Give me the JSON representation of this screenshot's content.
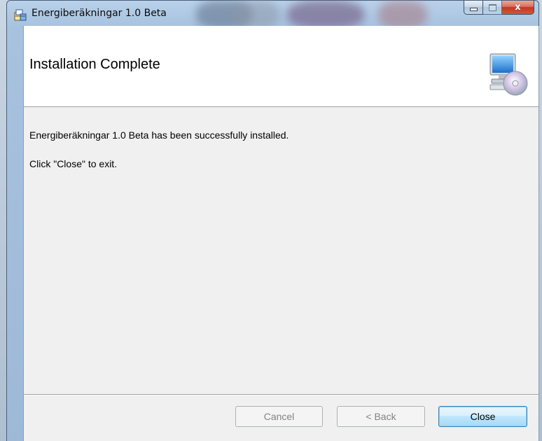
{
  "window": {
    "title": "Energiberäkningar 1.0 Beta",
    "caption": {
      "close_glyph": "x"
    }
  },
  "banner": {
    "heading": "Installation Complete",
    "icon": "computer-with-cd-icon"
  },
  "content": {
    "message": "Energiberäkningar 1.0 Beta has been successfully installed.",
    "instruction": "Click \"Close\" to exit."
  },
  "buttons": {
    "cancel": "Cancel",
    "back": "< Back",
    "close": "Close"
  },
  "colors": {
    "close_button_accent": "#3c7fb1",
    "caption_close": "#c0391f"
  }
}
